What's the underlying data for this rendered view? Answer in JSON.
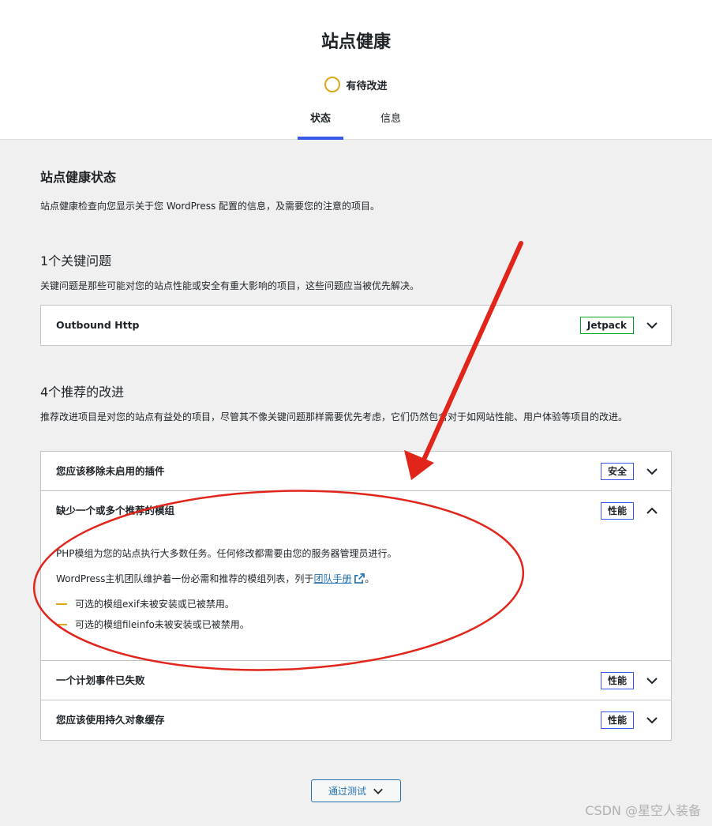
{
  "header": {
    "title": "站点健康",
    "progress_label": "有待改进",
    "tabs": [
      {
        "label": "状态",
        "active": true
      },
      {
        "label": "信息",
        "active": false
      }
    ]
  },
  "status": {
    "title": "站点健康状态",
    "description": "站点健康检查向您显示关于您 WordPress 配置的信息，及需要您的注意的项目。"
  },
  "critical": {
    "title": "1个关键问题",
    "description": "关键问题是那些可能对您的站点性能或安全有重大影响的项目，这些问题应当被优先解决。",
    "items": [
      {
        "title": "Outbound Http",
        "badge": "Jetpack"
      }
    ]
  },
  "recommended": {
    "title": "4个推荐的改进",
    "description": "推荐改进项目是对您的站点有益处的项目，尽管其不像关键问题那样需要优先考虑，它们仍然包含对于如网站性能、用户体验等项目的改进。",
    "items": [
      {
        "title": "您应该移除未启用的插件",
        "badge": "安全"
      },
      {
        "title": "缺少一个或多个推荐的模组",
        "badge": "性能",
        "expanded": true,
        "body_p1": "PHP模组为您的站点执行大多数任务。任何修改都需要由您的服务器管理员进行。",
        "body_p2_prefix": "WordPress主机团队维护着一份必需和推荐的模组列表，列于",
        "body_p2_link": "团队手册",
        "body_p2_suffix": "。",
        "bullets": [
          "可选的模组exif未被安装或已被禁用。",
          "可选的模组fileinfo未被安装或已被禁用。"
        ]
      },
      {
        "title": "一个计划事件已失败",
        "badge": "性能"
      },
      {
        "title": "您应该使用持久对象缓存",
        "badge": "性能"
      }
    ]
  },
  "pass_button": {
    "label": "通过测试"
  },
  "watermark": "CSDN @星空人装备",
  "colors": {
    "accent": "#3858e9",
    "warning": "#dba617",
    "link": "#2271b1",
    "annotation": "#e1251b",
    "jetpack": "#00a32a"
  }
}
